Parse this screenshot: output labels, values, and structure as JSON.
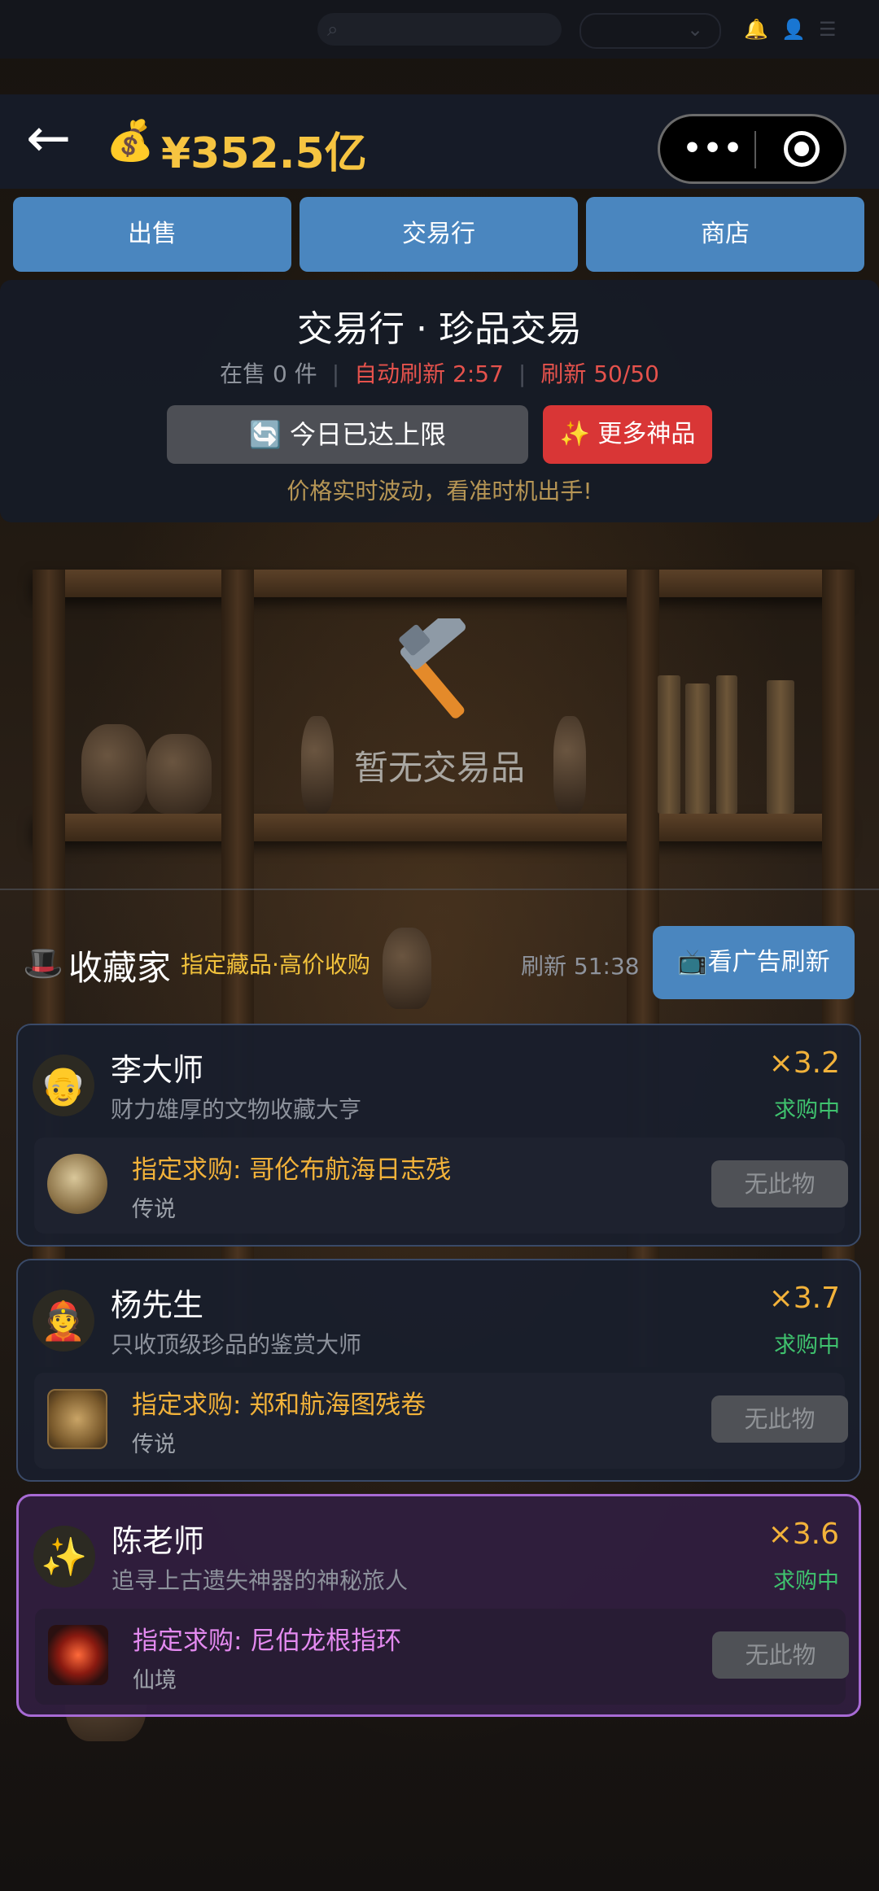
{
  "header": {
    "back_icon": "←",
    "money_icon": "💰",
    "money": "¥352.5亿",
    "capsule_dots": "•••"
  },
  "tabs": [
    {
      "label": "出售"
    },
    {
      "label": "交易行"
    },
    {
      "label": "商店"
    }
  ],
  "market": {
    "title": "交易行 · 珍品交易",
    "on_sale": "在售 0 件",
    "auto_refresh": "自动刷新 2:57",
    "refresh_count": "刷新 50/50",
    "limit_button": "🔄 今日已达上限",
    "more_button": "✨ 更多神品",
    "hint": "价格实时波动，看准时机出手!"
  },
  "empty": {
    "text": "暂无交易品",
    "icon": "hammer-icon"
  },
  "collectors": {
    "icon": "🎩",
    "title": "收藏家",
    "subtitle": "指定藏品·高价收购",
    "timer": "刷新 51:38",
    "ad_button": "📺看广告刷新",
    "items": [
      {
        "avatar": "👴",
        "name": "李大师",
        "desc": "财力雄厚的文物收藏大亨",
        "multiplier": "×3.2",
        "status": "求购中",
        "request": "指定求购: 哥伦布航海日志残",
        "rarity": "传说",
        "button": "无此物"
      },
      {
        "avatar": "👲",
        "name": "杨先生",
        "desc": "只收顶级珍品的鉴赏大师",
        "multiplier": "×3.7",
        "status": "求购中",
        "request": "指定求购: 郑和航海图残卷",
        "rarity": "传说",
        "button": "无此物"
      },
      {
        "avatar": "✨",
        "name": "陈老师",
        "desc": "追寻上古遗失神器的神秘旅人",
        "multiplier": "×3.6",
        "status": "求购中",
        "request": "指定求购: 尼伯龙根指环",
        "rarity": "仙境",
        "button": "无此物"
      }
    ]
  },
  "colors": {
    "accent_blue": "#4a86bf",
    "gold": "#f6c441",
    "red": "#d93636",
    "green": "#3fc26e",
    "purple": "#a76ad4"
  }
}
